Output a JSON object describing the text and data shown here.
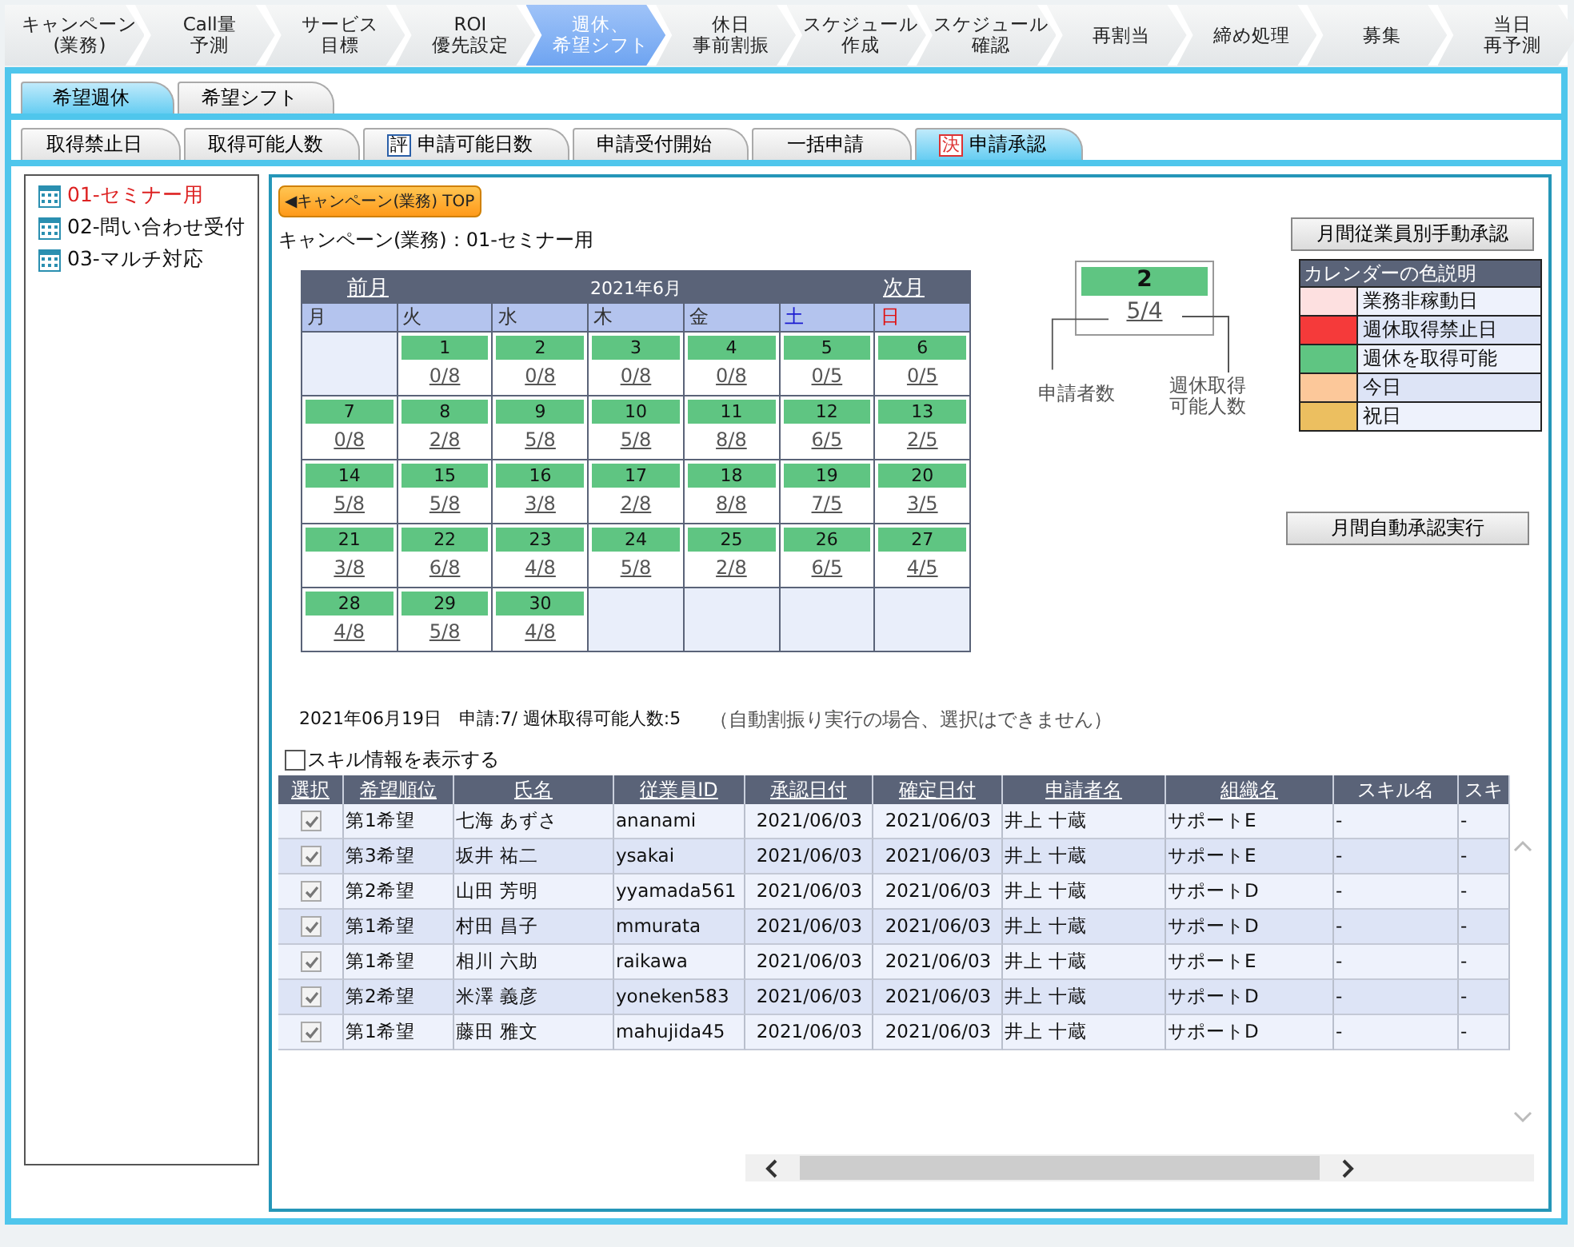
{
  "main_tabs": [
    {
      "lines": [
        "キャンペーン",
        "(業務)"
      ],
      "selected": false
    },
    {
      "lines": [
        "Call量",
        "予測"
      ],
      "selected": false
    },
    {
      "lines": [
        "サービス",
        "目標"
      ],
      "selected": false
    },
    {
      "lines": [
        "ROI",
        "優先設定"
      ],
      "selected": false
    },
    {
      "lines": [
        "週休、",
        "希望シフト"
      ],
      "selected": true
    },
    {
      "lines": [
        "休日",
        "事前割振"
      ],
      "selected": false
    },
    {
      "lines": [
        "スケジュール",
        "作成"
      ],
      "selected": false
    },
    {
      "lines": [
        "スケジュール",
        "確認"
      ],
      "selected": false
    },
    {
      "lines": [
        "再割当"
      ],
      "selected": false
    },
    {
      "lines": [
        "締め処理"
      ],
      "selected": false
    },
    {
      "lines": [
        "募集"
      ],
      "selected": false
    },
    {
      "lines": [
        "当日",
        "再予測"
      ],
      "selected": false
    }
  ],
  "sub_tabs": [
    {
      "label": "希望週休",
      "selected": true
    },
    {
      "label": "希望シフト",
      "selected": false
    }
  ],
  "function_tabs": [
    {
      "label": "取得禁止日",
      "selected": false
    },
    {
      "label": "取得可能人数",
      "selected": false
    },
    {
      "label": "申請可能日数",
      "badge": "評",
      "selected": false
    },
    {
      "label": "申請受付開始",
      "selected": false
    },
    {
      "label": "一括申請",
      "selected": false
    },
    {
      "label": "申請承認",
      "badge": "決",
      "selected": true
    }
  ],
  "sidebar": {
    "items": [
      {
        "label": "01-セミナー用",
        "selected": true
      },
      {
        "label": "02-問い合わせ受付",
        "selected": false
      },
      {
        "label": "03-マルチ対応",
        "selected": false
      }
    ]
  },
  "top_button": "◀キャンペーン(業務) TOP",
  "campaign_title": "キャンペーン(業務)：01-セミナー用",
  "calendar": {
    "prev": "前月",
    "title": "2021年6月",
    "next": "次月",
    "weekdays": [
      {
        "label": "月",
        "kind": "weekday"
      },
      {
        "label": "火",
        "kind": "weekday"
      },
      {
        "label": "水",
        "kind": "weekday"
      },
      {
        "label": "木",
        "kind": "weekday"
      },
      {
        "label": "金",
        "kind": "weekday"
      },
      {
        "label": "土",
        "kind": "saturday"
      },
      {
        "label": "日",
        "kind": "sunday"
      }
    ],
    "weeks": [
      [
        {
          "kind": "blank"
        },
        {
          "kind": "day",
          "day": "1",
          "count": "0/8"
        },
        {
          "kind": "day",
          "day": "2",
          "count": "0/8"
        },
        {
          "kind": "day",
          "day": "3",
          "count": "0/8"
        },
        {
          "kind": "day",
          "day": "4",
          "count": "0/8"
        },
        {
          "kind": "day",
          "day": "5",
          "count": "0/5"
        },
        {
          "kind": "day",
          "day": "6",
          "count": "0/5"
        }
      ],
      [
        {
          "kind": "day",
          "day": "7",
          "count": "0/8"
        },
        {
          "kind": "day",
          "day": "8",
          "count": "2/8"
        },
        {
          "kind": "day",
          "day": "9",
          "count": "5/8"
        },
        {
          "kind": "day",
          "day": "10",
          "count": "5/8"
        },
        {
          "kind": "day",
          "day": "11",
          "count": "8/8"
        },
        {
          "kind": "day",
          "day": "12",
          "count": "6/5"
        },
        {
          "kind": "day",
          "day": "13",
          "count": "2/5"
        }
      ],
      [
        {
          "kind": "day",
          "day": "14",
          "count": "5/8"
        },
        {
          "kind": "day",
          "day": "15",
          "count": "5/8"
        },
        {
          "kind": "day",
          "day": "16",
          "count": "3/8"
        },
        {
          "kind": "day",
          "day": "17",
          "count": "2/8"
        },
        {
          "kind": "day",
          "day": "18",
          "count": "8/8"
        },
        {
          "kind": "day",
          "day": "19",
          "count": "7/5"
        },
        {
          "kind": "day",
          "day": "20",
          "count": "3/5"
        }
      ],
      [
        {
          "kind": "day",
          "day": "21",
          "count": "3/8"
        },
        {
          "kind": "day",
          "day": "22",
          "count": "6/8"
        },
        {
          "kind": "day",
          "day": "23",
          "count": "4/8"
        },
        {
          "kind": "day",
          "day": "24",
          "count": "5/8"
        },
        {
          "kind": "day",
          "day": "25",
          "count": "2/8"
        },
        {
          "kind": "day",
          "day": "26",
          "count": "6/5"
        },
        {
          "kind": "day",
          "day": "27",
          "count": "4/5"
        }
      ],
      [
        {
          "kind": "day",
          "day": "28",
          "count": "4/8"
        },
        {
          "kind": "day",
          "day": "29",
          "count": "5/8"
        },
        {
          "kind": "day",
          "day": "30",
          "count": "4/8"
        },
        {
          "kind": "blank"
        },
        {
          "kind": "blank"
        },
        {
          "kind": "blank"
        },
        {
          "kind": "blank"
        }
      ]
    ]
  },
  "example": {
    "day": "2",
    "count": "5/4",
    "left_label": "申請者数",
    "right_label": [
      "週休取得",
      "可能人数"
    ]
  },
  "manual_approve_button": "月間従業員別手動承認",
  "legend": {
    "title": "カレンダーの色説明",
    "items": [
      {
        "label": "業務非稼動日",
        "color": "#fde0e0"
      },
      {
        "label": "週休取得禁止日",
        "color": "#f53a3a"
      },
      {
        "label": "週休を取得可能",
        "color": "#5fc582"
      },
      {
        "label": "今日",
        "color": "#fcc89a"
      },
      {
        "label": "祝日",
        "color": "#ecbf60"
      }
    ]
  },
  "auto_approve_button": "月間自動承認実行",
  "info_line": "2021年06月19日　申請:7/ 週休取得可能人数:5",
  "info_note": "（自動割振り実行の場合、選択はできません）",
  "skill_checkbox": {
    "label": "スキル情報を表示する",
    "checked": false
  },
  "table": {
    "columns": [
      {
        "label": "選択",
        "sortable": true
      },
      {
        "label": "希望順位",
        "sortable": true
      },
      {
        "label": "氏名",
        "sortable": true
      },
      {
        "label": "従業員ID",
        "sortable": true
      },
      {
        "label": "承認日付",
        "sortable": true
      },
      {
        "label": "確定日付",
        "sortable": true
      },
      {
        "label": "申請者名",
        "sortable": true
      },
      {
        "label": "組織名",
        "sortable": true
      },
      {
        "label": "スキル名",
        "sortable": false
      },
      {
        "label": "スキ",
        "sortable": false
      }
    ],
    "rows": [
      {
        "checked": true,
        "cells": [
          "",
          "第1希望",
          "七海 あずさ",
          "ananami",
          "2021/06/03",
          "2021/06/03",
          "井上 十蔵",
          "サポートE",
          "-",
          "-"
        ]
      },
      {
        "checked": true,
        "cells": [
          "",
          "第3希望",
          "坂井 祐二",
          "ysakai",
          "2021/06/03",
          "2021/06/03",
          "井上 十蔵",
          "サポートE",
          "-",
          "-"
        ]
      },
      {
        "checked": true,
        "cells": [
          "",
          "第2希望",
          "山田 芳明",
          "yyamada561",
          "2021/06/03",
          "2021/06/03",
          "井上 十蔵",
          "サポートD",
          "-",
          "-"
        ]
      },
      {
        "checked": true,
        "cells": [
          "",
          "第1希望",
          "村田 昌子",
          "mmurata",
          "2021/06/03",
          "2021/06/03",
          "井上 十蔵",
          "サポートD",
          "-",
          "-"
        ]
      },
      {
        "checked": true,
        "cells": [
          "",
          "第1希望",
          "相川 六助",
          "raikawa",
          "2021/06/03",
          "2021/06/03",
          "井上 十蔵",
          "サポートE",
          "-",
          "-"
        ]
      },
      {
        "checked": true,
        "cells": [
          "",
          "第2希望",
          "米澤 義彦",
          "yoneken583",
          "2021/06/03",
          "2021/06/03",
          "井上 十蔵",
          "サポートD",
          "-",
          "-"
        ]
      },
      {
        "checked": true,
        "cells": [
          "",
          "第1希望",
          "藤田 雅文",
          "mahujida45",
          "2021/06/03",
          "2021/06/03",
          "井上 十蔵",
          "サポートD",
          "-",
          "-"
        ]
      }
    ]
  }
}
